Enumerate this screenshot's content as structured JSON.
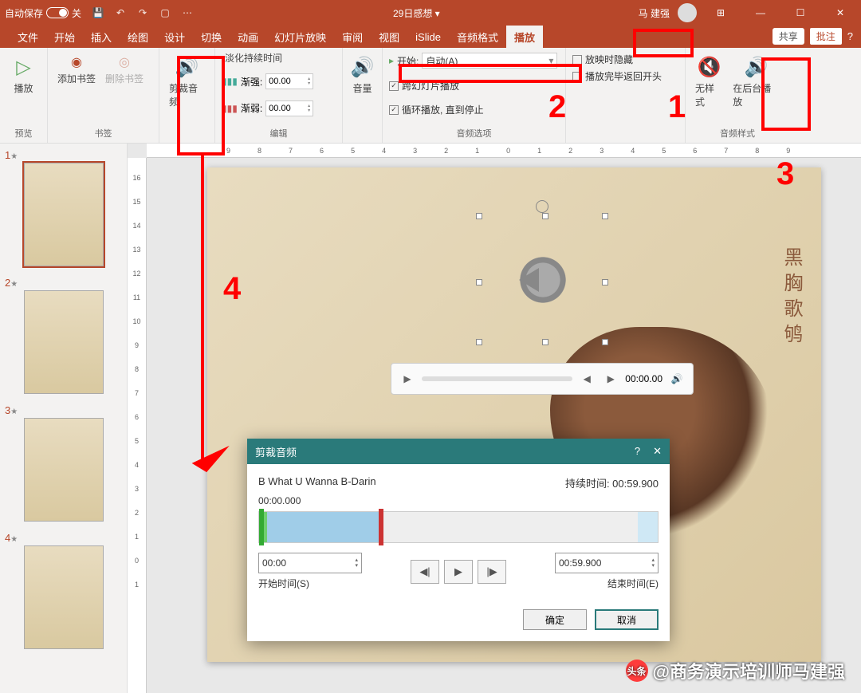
{
  "titlebar": {
    "autosave_label": "自动保存",
    "autosave_state": "关",
    "doc_title": "29日感想 ▾",
    "username": "马 建强"
  },
  "tabs": {
    "file": "文件",
    "home": "开始",
    "insert": "插入",
    "draw": "绘图",
    "design": "设计",
    "transitions": "切换",
    "animations": "动画",
    "slideshow": "幻灯片放映",
    "review": "审阅",
    "view": "视图",
    "islide": "iSlide",
    "audio_format": "音频格式",
    "playback": "播放",
    "share": "共享",
    "comments": "批注"
  },
  "ribbon": {
    "preview_btn": "播放",
    "preview_group": "预览",
    "add_bookmark": "添加书签",
    "remove_bookmark": "删除书签",
    "bookmark_group": "书签",
    "trim_audio": "剪裁音频",
    "fade_label": "淡化持续时间",
    "fade_in_label": "渐强:",
    "fade_in_val": "00.00",
    "fade_out_label": "渐弱:",
    "fade_out_val": "00.00",
    "edit_group": "编辑",
    "volume": "音量",
    "start_label": "开始:",
    "start_value": "自动(A)",
    "across_slides": "跨幻灯片播放",
    "loop": "循环播放, 直到停止",
    "hide_during": "放映时隐藏",
    "rewind": "播放完毕返回开头",
    "options_group": "音频选项",
    "no_style": "无样式",
    "play_bg": "在后台播放",
    "style_group": "音频样式"
  },
  "annotations": {
    "n1": "1",
    "n2": "2",
    "n3": "3",
    "n4": "4"
  },
  "thumbs": {
    "s1": "1",
    "s2": "2",
    "s3": "3",
    "s4": "4"
  },
  "ruler_h": [
    "9",
    "8",
    "7",
    "6",
    "5",
    "4",
    "3",
    "2",
    "1",
    "0",
    "1",
    "2",
    "3",
    "4",
    "5",
    "6",
    "7",
    "8",
    "9"
  ],
  "ruler_v": [
    "16",
    "15",
    "14",
    "13",
    "12",
    "11",
    "10",
    "9",
    "8",
    "7",
    "6",
    "5",
    "4",
    "3",
    "2",
    "1",
    "0",
    "1"
  ],
  "slide": {
    "vertical_text": "黑胸歌鸲"
  },
  "player": {
    "time": "00:00.00"
  },
  "dialog": {
    "title": "剪裁音频",
    "track": "B What U Wanna B-Darin",
    "duration_label": "持续时间: 00:59.900",
    "cur_time": "00:00.000",
    "start_val": "00:00",
    "start_label": "开始时间(S)",
    "end_val": "00:59.900",
    "end_label": "结束时间(E)",
    "ok": "确定",
    "cancel": "取消"
  },
  "watermark": {
    "prefix": "头条",
    "text": "@商务演示培训师马建强"
  }
}
